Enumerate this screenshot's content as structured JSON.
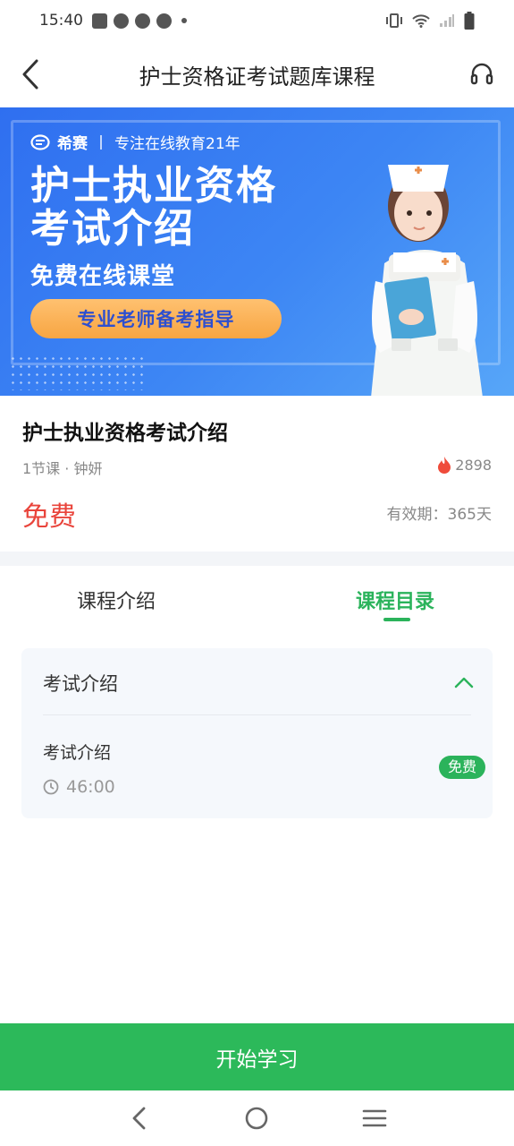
{
  "status_bar": {
    "time": "15:40"
  },
  "nav": {
    "title": "护士资格证考试题库课程"
  },
  "banner": {
    "brand": "希赛",
    "tagline": "专注在线教育21年",
    "headline_line1": "护士执业资格",
    "headline_line2": "考试介绍",
    "subheadline": "免费在线课堂",
    "pill": "专业老师备考指导"
  },
  "course": {
    "title": "护士执业资格考试介绍",
    "meta": "1节课 · 钟妍",
    "hot_count": "2898",
    "price": "免费",
    "validity": "有效期：365天"
  },
  "tabs": [
    {
      "label": "课程介绍",
      "active": false
    },
    {
      "label": "课程目录",
      "active": true
    }
  ],
  "catalog": {
    "chapter_title": "考试介绍",
    "lessons": [
      {
        "title": "考试介绍",
        "duration": "46:00",
        "badge": "免费"
      }
    ]
  },
  "cta": {
    "label": "开始学习"
  },
  "colors": {
    "accent": "#2cb95a",
    "price": "#e9443b",
    "banner": "#3d86f4"
  }
}
